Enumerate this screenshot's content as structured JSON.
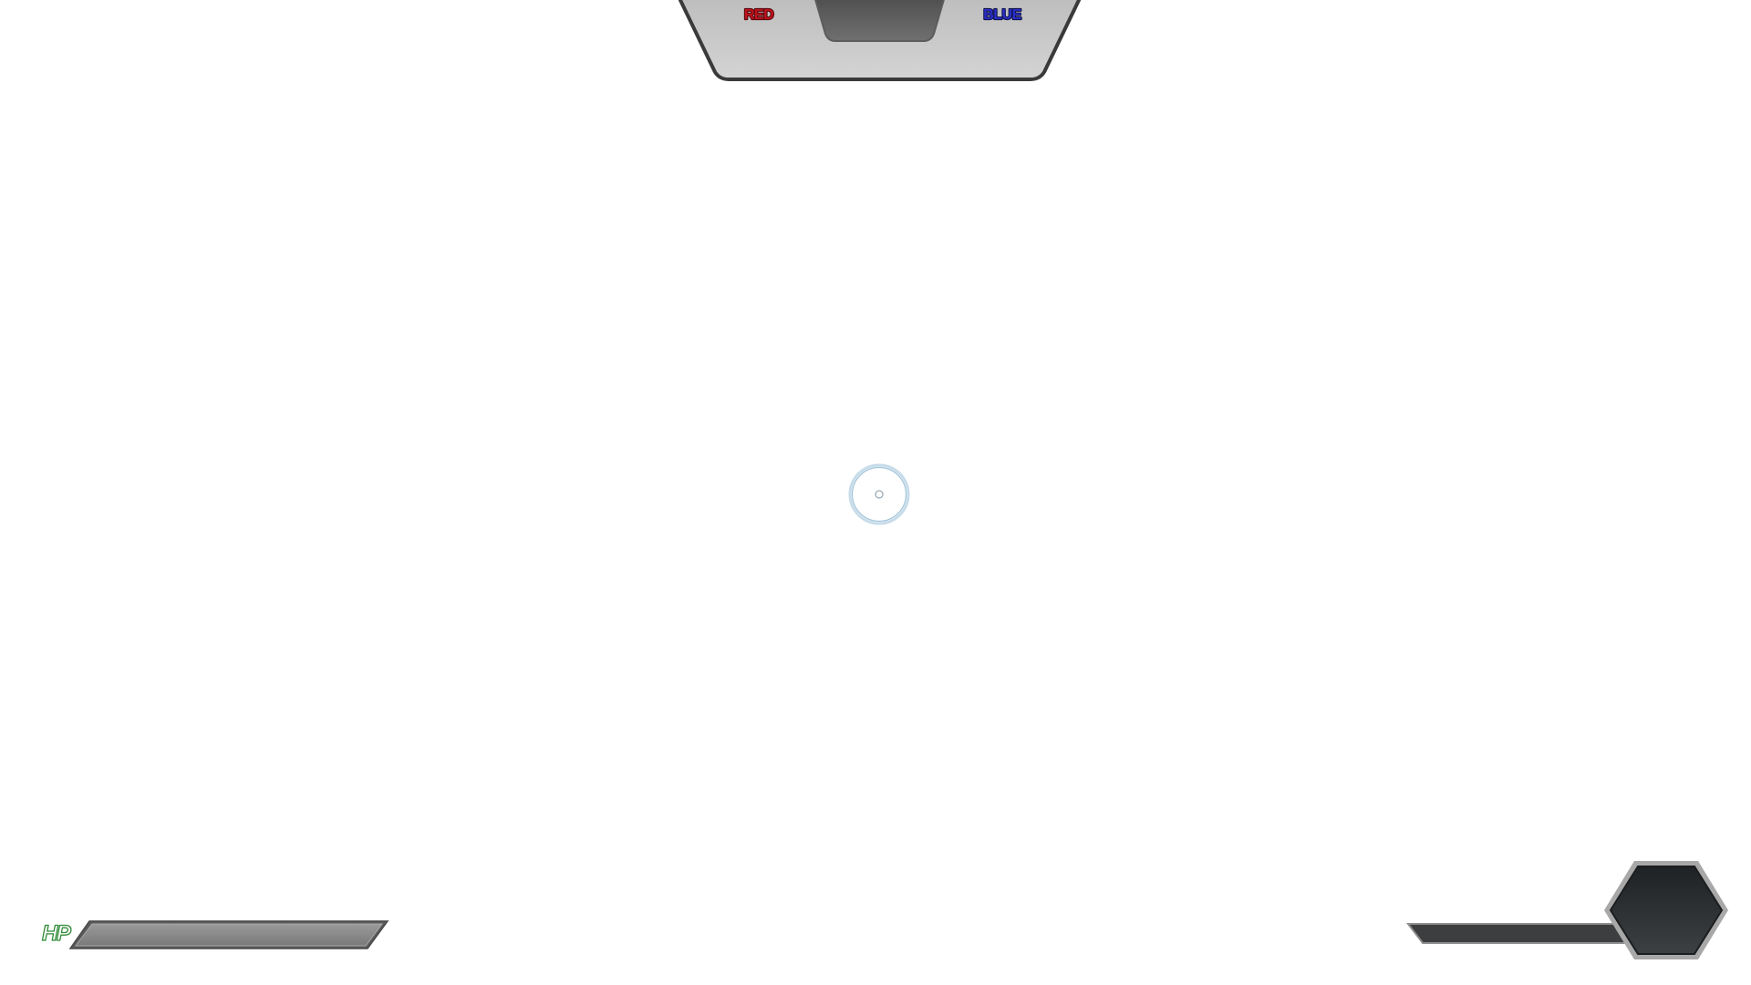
{
  "scoreboard": {
    "red_label": "RED",
    "blue_label": "BLUE",
    "red_color": "#c0121d",
    "blue_color": "#2a2fc9"
  },
  "crosshair": {
    "icon": "crosshair-icon",
    "color": "#a9cbe0"
  },
  "health": {
    "label": "HP",
    "label_color": "#2f8a36"
  },
  "ability": {
    "icon": "hexagon-ability-icon"
  }
}
